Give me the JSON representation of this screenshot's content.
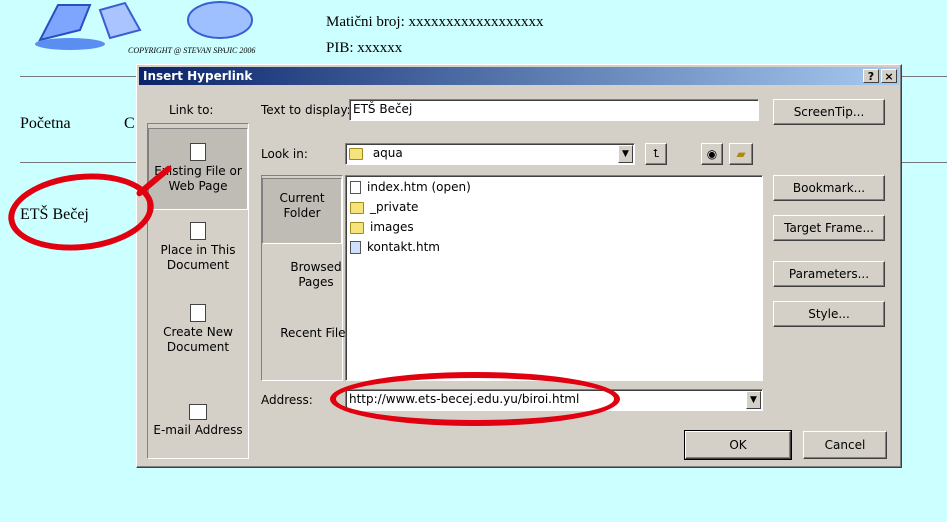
{
  "background": {
    "copyright": "COPYRIGHT @ STEVAN SPAJIC 2006",
    "maticni_broj": "Matični broj: xxxxxxxxxxxxxxxxxx",
    "pib": "PIB: xxxxxx",
    "nav_home": "Početna",
    "nav_next_letter": "C",
    "left_link": "ETŠ Bečej"
  },
  "dialog": {
    "title": "Insert Hyperlink",
    "help_btn": "?",
    "close_btn": "×",
    "link_to_label": "Link to:",
    "link_to_items": [
      "Existing File or Web Page",
      "Place in This Document",
      "Create New Document",
      "E-mail Address"
    ],
    "text_to_display_label": "Text to display:",
    "text_to_display_value": "ETŠ Bečej",
    "screentip_button": "ScreenTip...",
    "look_in_label": "Look in:",
    "look_in_value": "aqua",
    "nav_tabs": [
      "Current Folder",
      "Browsed Pages",
      "Recent Files"
    ],
    "files": [
      {
        "name": "index.htm (open)",
        "icon": "ie-page-icon"
      },
      {
        "name": "_private",
        "icon": "folder-icon"
      },
      {
        "name": "images",
        "icon": "folder-icon"
      },
      {
        "name": "kontakt.htm",
        "icon": "html-page-icon"
      }
    ],
    "side_buttons": [
      "Bookmark...",
      "Target Frame...",
      "Parameters...",
      "Style..."
    ],
    "address_label": "Address:",
    "address_value": "http://www.ets-becej.edu.yu/biroi.html",
    "ok_button": "OK",
    "cancel_button": "Cancel"
  },
  "colors": {
    "page_bg": "#ccffff",
    "dialog_bg": "#d4d0c8",
    "titlebar": "#0a246a",
    "annotation": "#e00010"
  }
}
